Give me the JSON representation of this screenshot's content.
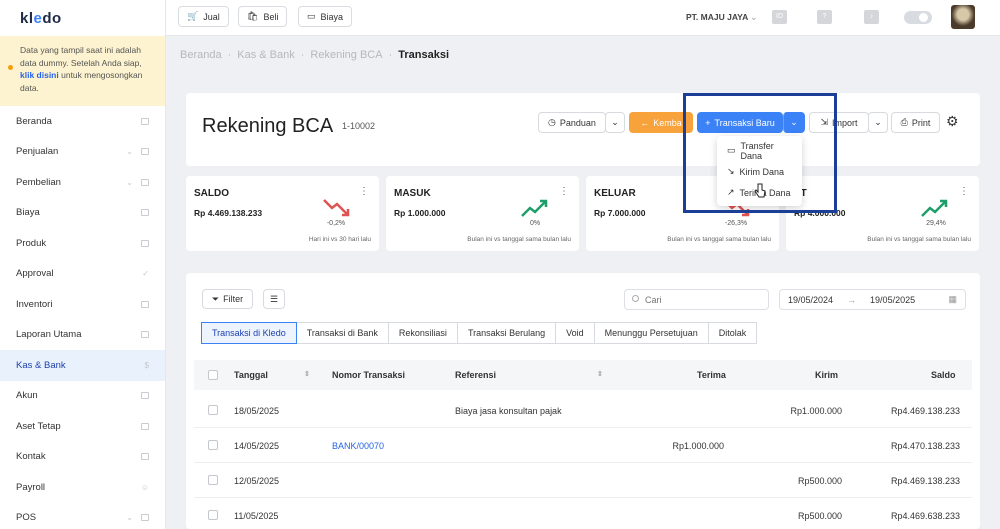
{
  "logo": {
    "text_pre": "kl",
    "text_acc": "e",
    "text_post": "do"
  },
  "notice": {
    "before": "Data yang tampil saat ini adalah data dummy. Setelah Anda siap, ",
    "link": "klik disini",
    "after": " untuk mengosongkan data."
  },
  "sidebar": {
    "items": [
      {
        "label": "Beranda"
      },
      {
        "label": "Penjualan"
      },
      {
        "label": "Pembelian"
      },
      {
        "label": "Biaya"
      },
      {
        "label": "Produk"
      },
      {
        "label": "Approval"
      },
      {
        "label": "Inventori"
      },
      {
        "label": "Laporan Utama"
      },
      {
        "label": "Kas & Bank"
      },
      {
        "label": "Akun"
      },
      {
        "label": "Aset Tetap"
      },
      {
        "label": "Kontak"
      },
      {
        "label": "Payroll"
      },
      {
        "label": "POS"
      }
    ]
  },
  "topbar": {
    "jual": "Jual",
    "beli": "Beli",
    "biaya": "Biaya",
    "company": "PT. MAJU JAYA",
    "id_badge": "ID"
  },
  "breadcrumb": {
    "b1": "Beranda",
    "b2": "Kas & Bank",
    "b3": "Rekening BCA",
    "b4": "Transaksi",
    "sep": "·"
  },
  "header": {
    "title": "Rekening BCA",
    "code": "1-10002",
    "panduan": "Panduan",
    "kembali": "Kemba",
    "transaksi_baru": "Transaksi Baru",
    "import": "Import",
    "print": "Print"
  },
  "stats": [
    {
      "label": "SALDO",
      "value": "Rp 4.469.138.233",
      "pct": "-0,2%",
      "compare": "Hari ini vs 30 hari lalu"
    },
    {
      "label": "MASUK",
      "value": "Rp 1.000.000",
      "pct": "0%",
      "compare": "Bulan ini vs tanggal sama bulan lalu"
    },
    {
      "label": "KELUAR",
      "value": "Rp 7.000.000",
      "pct": "-26,3%",
      "compare": "Bulan ini vs tanggal sama bulan lalu"
    },
    {
      "label": "ET",
      "value": "Rp 4.000.000",
      "pct": "29,4%",
      "compare": "Bulan ini vs tanggal sama bulan lalu"
    }
  ],
  "dropdown": {
    "items": [
      "Transfer Dana",
      "Kirim Dana",
      "Terima Dana"
    ]
  },
  "filters": {
    "filter": "Filter",
    "search_placeholder": "Cari",
    "date_from": "19/05/2024",
    "date_sep": "→",
    "date_to": "19/05/2025"
  },
  "tabs": [
    "Transaksi di Kledo",
    "Transaksi di Bank",
    "Rekonsiliasi",
    "Transaksi Berulang",
    "Void",
    "Menunggu Persetujuan",
    "Ditolak"
  ],
  "table": {
    "headers": {
      "tanggal": "Tanggal",
      "nomor": "Nomor Transaksi",
      "referensi": "Referensi",
      "terima": "Terima",
      "kirim": "Kirim",
      "saldo": "Saldo"
    },
    "rows": [
      {
        "tanggal": "18/05/2025",
        "nomor": "",
        "referensi": "Biaya jasa konsultan pajak",
        "terima": "",
        "kirim": "Rp1.000.000",
        "saldo": "Rp4.469.138.233"
      },
      {
        "tanggal": "14/05/2025",
        "nomor": "BANK/00070",
        "referensi": "",
        "terima": "Rp1.000.000",
        "kirim": "",
        "saldo": "Rp4.470.138.233"
      },
      {
        "tanggal": "12/05/2025",
        "nomor": "",
        "referensi": "",
        "terima": "",
        "kirim": "Rp500.000",
        "saldo": "Rp4.469.138.233"
      },
      {
        "tanggal": "11/05/2025",
        "nomor": "",
        "referensi": "",
        "terima": "",
        "kirim": "Rp500.000",
        "saldo": "Rp4.469.638.233"
      }
    ]
  },
  "colors": {
    "primary": "#3b82f6",
    "orange": "#f7a23a",
    "notice_bg": "#fdf3d0",
    "down": "#e05252",
    "up": "#1e9e6a",
    "highlight": "#1b3f97"
  }
}
